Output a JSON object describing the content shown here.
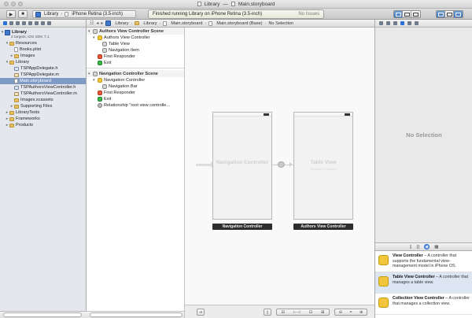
{
  "window": {
    "project": "Library",
    "separator": "—",
    "file": "Main.storyboard"
  },
  "toolbar": {
    "run_icon": "play-icon",
    "stop_icon": "stop-icon",
    "scheme_target": "Library",
    "scheme_device": "iPhone Retina (3.5-inch)",
    "activity_status": "Finished running Library on iPhone Retina (3.5-inch)",
    "issues": "No Issues"
  },
  "navigator": {
    "project_name": "Library",
    "project_sub": "2 targets, iOS SDK 7.1",
    "items": [
      {
        "label": "Resources",
        "type": "folder",
        "depth": 1,
        "open": true
      },
      {
        "label": "Books.plist",
        "type": "file",
        "depth": 2
      },
      {
        "label": "Images",
        "type": "folder",
        "depth": 2,
        "open": false
      },
      {
        "label": "Library",
        "type": "folder",
        "depth": 1,
        "open": true
      },
      {
        "label": "TSPAppDelegate.h",
        "type": "h",
        "depth": 2
      },
      {
        "label": "TSPAppDelegate.m",
        "type": "m",
        "depth": 2
      },
      {
        "label": "Main.storyboard",
        "type": "file",
        "depth": 2,
        "selected": true
      },
      {
        "label": "TSPAuthorsViewController.h",
        "type": "h",
        "depth": 2
      },
      {
        "label": "TSPAuthorsViewController.m",
        "type": "m",
        "depth": 2
      },
      {
        "label": "Images.xcassets",
        "type": "file",
        "depth": 2
      },
      {
        "label": "Supporting Files",
        "type": "folder",
        "depth": 2,
        "open": false
      },
      {
        "label": "LibraryTests",
        "type": "folder",
        "depth": 1,
        "open": false
      },
      {
        "label": "Frameworks",
        "type": "folder",
        "depth": 1,
        "open": false
      },
      {
        "label": "Products",
        "type": "folder",
        "depth": 1,
        "open": false
      }
    ]
  },
  "jumpbar": {
    "crumbs": [
      "Library",
      "Library",
      "Main.storyboard",
      "Main.storyboard (Base)",
      "No Selection"
    ]
  },
  "outline": {
    "scene1_title": "Authors View Controller Scene",
    "scene1": [
      "Authors View Controller",
      "Table View",
      "Navigation Item",
      "First Responder",
      "Exit"
    ],
    "scene2_title": "Navigation Controller Scene",
    "scene2": [
      "Navigation Controller",
      "Navigation Bar",
      "First Responder",
      "Exit",
      "Relationship \"root view controlle..."
    ]
  },
  "canvas": {
    "nav_controller_label": "Navigation Controller",
    "table_view_label": "Table View",
    "table_view_sub": "Prototype Content",
    "nav_controller_bar": "Navigation Controller",
    "authors_bar": "Authors View Controller"
  },
  "inspector": {
    "empty_text": "No Selection"
  },
  "library": {
    "items": [
      {
        "title": "View Controller",
        "desc": " – A controller that supports the fundamental view-management model in iPhone OS."
      },
      {
        "title": "Table View Controller",
        "desc": " – A controller that manages a table view."
      },
      {
        "title": "Collection View Controller",
        "desc": " – A controller that manages a collection view."
      }
    ]
  }
}
